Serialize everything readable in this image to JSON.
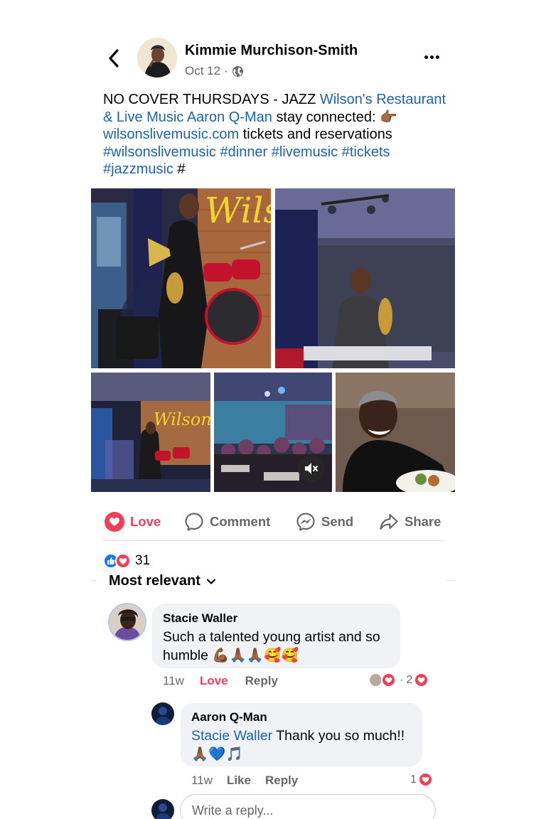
{
  "post": {
    "author": "Kimmie Murchison-Smith",
    "date": "Oct 12",
    "separator": "·",
    "text_segments": [
      {
        "text": "NO COVER THURSDAYS - JAZZ ",
        "link": false
      },
      {
        "text": "Wilson's Restaurant & Live Music",
        "link": true
      },
      {
        "text": " ",
        "link": false
      },
      {
        "text": "Aaron Q-Man",
        "link": true
      },
      {
        "text": " stay connected: 👉🏾 ",
        "link": false
      },
      {
        "text": "wilsonslivemusic.com",
        "link": true
      },
      {
        "text": " tickets and reservations ",
        "link": false
      },
      {
        "text": "#wilsonslivemusic",
        "link": true
      },
      {
        "text": " ",
        "link": false
      },
      {
        "text": "#dinner",
        "link": true
      },
      {
        "text": " ",
        "link": false
      },
      {
        "text": "#livemusic",
        "link": true
      },
      {
        "text": " ",
        "link": false
      },
      {
        "text": "#tickets",
        "link": true
      },
      {
        "text": " ",
        "link": false
      },
      {
        "text": "#jazzmusic",
        "link": true
      },
      {
        "text": " #",
        "link": false
      }
    ],
    "photo_sign_text": "Wilson's"
  },
  "actions": {
    "love": "Love",
    "comment": "Comment",
    "send": "Send",
    "share": "Share"
  },
  "reactions": {
    "count": "31"
  },
  "sort": {
    "label": "Most relevant"
  },
  "comments": [
    {
      "name": "Stacie Waller",
      "text": "Such a talented young artist and so humble 💪🏾🙏🏾🙏🏾🥰🥰",
      "time": "11w",
      "reaction_label": "Love",
      "reply_label": "Reply",
      "replies_count": "2",
      "separator": "·"
    },
    {
      "name": "Aaron Q-Man",
      "mention": "Stacie Waller",
      "text": " Thank you so much!! 🙏🏾💙🎵",
      "time": "11w",
      "like_label": "Like",
      "reply_label": "Reply",
      "reaction_count": "1"
    }
  ],
  "reply_input": {
    "placeholder": "Write a reply..."
  },
  "colors": {
    "link": "#1b63b5",
    "love": "#f33e58",
    "like": "#1877f2",
    "secondary_text": "#65676b"
  }
}
